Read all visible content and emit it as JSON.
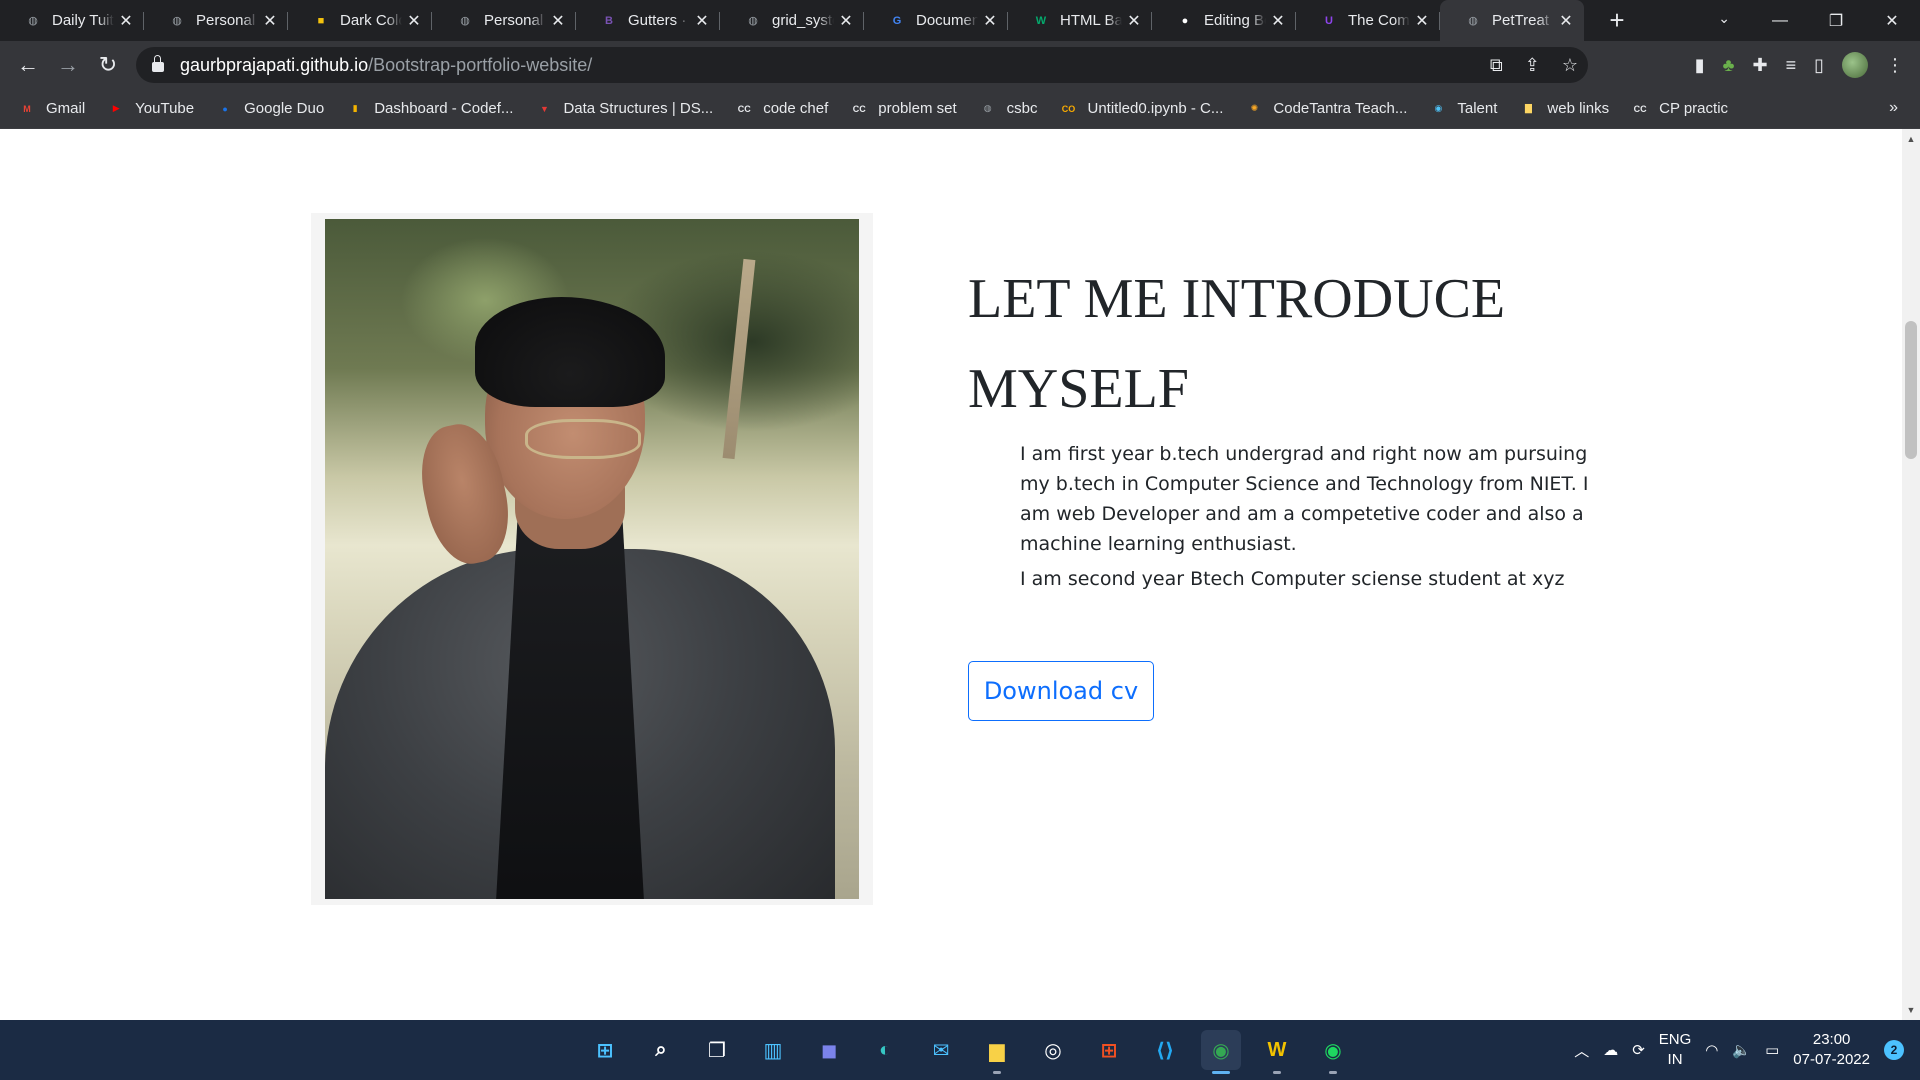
{
  "browser": {
    "tabs": [
      {
        "title": "Daily Tuit",
        "favicon": "globe-icon",
        "color": "#9aa0a6",
        "glyph": "◍"
      },
      {
        "title": "Personal",
        "favicon": "globe-icon",
        "color": "#9aa0a6",
        "glyph": "◍"
      },
      {
        "title": "Dark Colo",
        "favicon": "palette-icon",
        "color": "#f4c20d",
        "glyph": "■"
      },
      {
        "title": "Personal",
        "favicon": "globe-icon",
        "color": "#9aa0a6",
        "glyph": "◍"
      },
      {
        "title": "Gutters · B",
        "favicon": "bootstrap-icon",
        "color": "#7952b3",
        "glyph": "B"
      },
      {
        "title": "grid_syste",
        "favicon": "globe-icon",
        "color": "#9aa0a6",
        "glyph": "◍"
      },
      {
        "title": "Documen",
        "favicon": "google-icon",
        "color": "#4285f4",
        "glyph": "G"
      },
      {
        "title": "HTML Ba",
        "favicon": "w3-icon",
        "color": "#04aa6d",
        "glyph": "W"
      },
      {
        "title": "Editing Bo",
        "favicon": "github-icon",
        "color": "#ffffff",
        "glyph": "●"
      },
      {
        "title": "The Com",
        "favicon": "user-icon",
        "color": "#8e44ec",
        "glyph": "U"
      },
      {
        "title": "PetTreat",
        "favicon": "globe-icon",
        "color": "#9aa0a6",
        "glyph": "◍",
        "active": true
      }
    ],
    "url_host": "gaurbprajapati.github.io",
    "url_path": "/Bootstrap-portfolio-website/",
    "bookmarks": [
      {
        "label": "Gmail",
        "icon": "gmail-icon",
        "color": "#ea4335",
        "glyph": "M"
      },
      {
        "label": "YouTube",
        "icon": "youtube-icon",
        "color": "#ff0000",
        "glyph": "▶"
      },
      {
        "label": "Google Duo",
        "icon": "duo-icon",
        "color": "#1a73e8",
        "glyph": "●"
      },
      {
        "label": "Dashboard - Codef...",
        "icon": "codeforces-icon",
        "color": "#f4b400",
        "glyph": "▮"
      },
      {
        "label": "Data Structures | DS...",
        "icon": "triangle-icon",
        "color": "#e53935",
        "glyph": "▼"
      },
      {
        "label": "code chef",
        "icon": "codechef-icon",
        "color": "#e8eaed",
        "glyph": "CC"
      },
      {
        "label": "problem set",
        "icon": "codechef-icon",
        "color": "#e8eaed",
        "glyph": "CC"
      },
      {
        "label": "csbc",
        "icon": "globe-icon",
        "color": "#9aa0a6",
        "glyph": "◍"
      },
      {
        "label": "Untitled0.ipynb - C...",
        "icon": "colab-icon",
        "color": "#f9ab00",
        "glyph": "CO"
      },
      {
        "label": "CodeTantra Teach...",
        "icon": "sun-icon",
        "color": "#f9a825",
        "glyph": "✺"
      },
      {
        "label": "Talent",
        "icon": "talent-icon",
        "color": "#4fc3f7",
        "glyph": "◉"
      },
      {
        "label": "web links",
        "icon": "folder-icon",
        "color": "#fdd663",
        "glyph": "▇"
      },
      {
        "label": "CP practic",
        "icon": "codechef-icon",
        "color": "#e8eaed",
        "glyph": "CC"
      }
    ]
  },
  "intro": {
    "heading": "LET ME INTRODUCE MYSELF",
    "para1": "I am first year b.tech undergrad and right now am pursuing my b.tech in Computer Science and Technology from NIET. I am web Developer and am a competetive coder and also a machine learning enthusiast.",
    "para2": "I am second year Btech Computer sciense student at xyz",
    "cv_button": "Download cv"
  },
  "taskbar": {
    "apps": [
      {
        "icon": "windows-start-icon",
        "glyph": "⊞",
        "color": "#4cc2ff",
        "running": false
      },
      {
        "icon": "search-icon",
        "glyph": "⌕",
        "color": "#ffffff",
        "running": false
      },
      {
        "icon": "task-view-icon",
        "glyph": "❐",
        "color": "#ffffff",
        "running": false
      },
      {
        "icon": "widgets-icon",
        "glyph": "▥",
        "color": "#4cc2ff",
        "running": false
      },
      {
        "icon": "teams-chat-icon",
        "glyph": "◼",
        "color": "#7b83eb",
        "running": false
      },
      {
        "icon": "edge-icon",
        "glyph": "◐",
        "color": "#36c7c4",
        "running": false
      },
      {
        "icon": "mail-icon",
        "glyph": "✉",
        "color": "#4cc2ff",
        "running": false
      },
      {
        "icon": "file-explorer-icon",
        "glyph": "▆",
        "color": "#f8d147",
        "running": true
      },
      {
        "icon": "dell-icon",
        "glyph": "◎",
        "color": "#ffffff",
        "running": false
      },
      {
        "icon": "microsoft-store-icon",
        "glyph": "⊞",
        "color": "#f25022",
        "running": false
      },
      {
        "icon": "vscode-icon",
        "glyph": "⟨⟩",
        "color": "#23a9f2",
        "running": false
      },
      {
        "icon": "chrome-icon",
        "glyph": "◉",
        "color": "#34a853",
        "running": true,
        "active": true
      },
      {
        "icon": "w-app-icon",
        "glyph": "W",
        "color": "#f2c200",
        "running": true
      },
      {
        "icon": "spotify-icon",
        "glyph": "◉",
        "color": "#1ed760",
        "running": true
      }
    ],
    "lang_line1": "ENG",
    "lang_line2": "IN",
    "time": "23:00",
    "date": "07-07-2022",
    "notification_count": "2"
  }
}
